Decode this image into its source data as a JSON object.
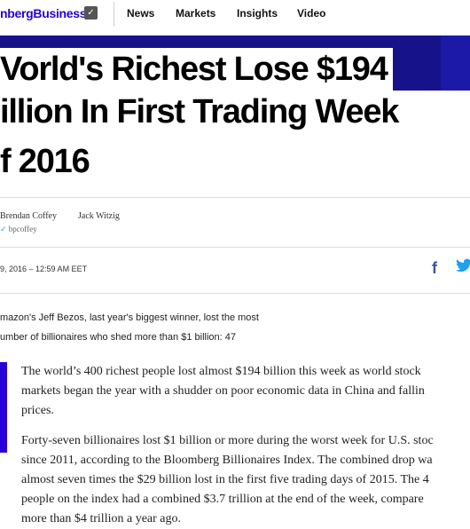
{
  "header": {
    "logo_text": "nbergBusiness",
    "nav": [
      "News",
      "Markets",
      "Insights",
      "Video"
    ]
  },
  "headline": {
    "line1": "Vorld's Richest Lose $194",
    "line2": "illion In First Trading Week",
    "line3": "f 2016"
  },
  "authors": {
    "author1": "Brendan Coffey",
    "author2": "Jack Witzig",
    "twitter_handle": "bpcoffey"
  },
  "date_text": "9, 2016 – 12:59 AM EET",
  "social": {
    "facebook": "f",
    "twitter": "twitter"
  },
  "bullets": [
    "mazon's Jeff Bezos, last year's biggest winner, lost the most",
    "umber of billionaires who shed more than $1 billion: 47"
  ],
  "paragraphs": {
    "p1": [
      "The world’s 400 richest people lost almost $194 billion this week as world stock",
      "markets began the year with a shudder on poor economic data in China and fallin",
      "prices."
    ],
    "p2": [
      "Forty-seven billionaires lost $1 billion or more during the worst week for U.S. stoc",
      "since 2011, according to the Bloomberg Billionaires Index. The combined drop wa",
      "almost seven times the $29 billion lost in the first five trading days of 2015. The 4",
      "people on the index had a combined $3.7 trillion at the end of the week, compare",
      "more than $4 trillion a year ago."
    ]
  },
  "colors": {
    "brand": "#2800d7",
    "hero": "#16138a",
    "twitter": "#1da1f2",
    "facebook": "#3b5998"
  }
}
